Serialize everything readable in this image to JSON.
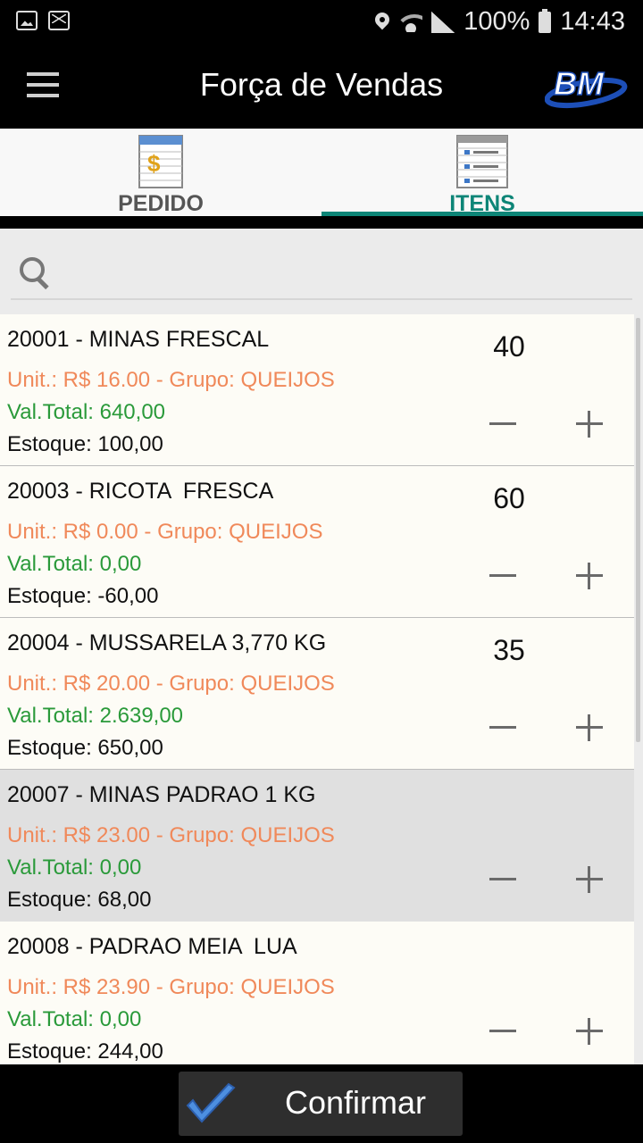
{
  "status_bar": {
    "battery": "100%",
    "time": "14:43",
    "icons": [
      "gallery-icon",
      "mail-icon",
      "location-icon",
      "wifi-icon",
      "signal-icon",
      "battery-icon"
    ]
  },
  "app_bar": {
    "title": "Força de Vendas",
    "logo_text": "BM"
  },
  "tabs": [
    {
      "label": "PEDIDO",
      "icon": "invoice-icon",
      "active": false
    },
    {
      "label": "ITENS",
      "icon": "list-sheet-icon",
      "active": true
    }
  ],
  "search": {
    "placeholder": "",
    "value": ""
  },
  "items": [
    {
      "name": "20001 - MINAS FRESCAL",
      "unit": "Unit.: R$ 16.00 - Grupo: QUEIJOS",
      "total": "Val.Total: 640,00",
      "stock": "Estoque: 100,00",
      "qty": "40",
      "highlighted": false
    },
    {
      "name": "20003 - RICOTA  FRESCA",
      "unit": "Unit.: R$ 0.00 - Grupo: QUEIJOS",
      "total": "Val.Total: 0,00",
      "stock": "Estoque: -60,00",
      "qty": "60",
      "highlighted": false
    },
    {
      "name": "20004 - MUSSARELA 3,770 KG",
      "unit": "Unit.: R$ 20.00 - Grupo: QUEIJOS",
      "total": "Val.Total: 2.639,00",
      "stock": "Estoque: 650,00",
      "qty": "35",
      "highlighted": false
    },
    {
      "name": "20007 - MINAS PADRAO 1 KG",
      "unit": "Unit.: R$ 23.00 - Grupo: QUEIJOS",
      "total": "Val.Total: 0,00",
      "stock": "Estoque: 68,00",
      "qty": "",
      "highlighted": true
    },
    {
      "name": "20008 - PADRAO MEIA  LUA",
      "unit": "Unit.: R$ 23.90 - Grupo: QUEIJOS",
      "total": "Val.Total: 0,00",
      "stock": "Estoque: 244,00",
      "qty": "",
      "highlighted": false
    }
  ],
  "bottom": {
    "confirm_label": "Confirmar",
    "confirm_icon": "checkmark-icon"
  },
  "colors": {
    "accent": "#0d8577",
    "price": "#f0895a",
    "total": "#2a9a3a",
    "highlight_row": "#e0e0e0"
  }
}
